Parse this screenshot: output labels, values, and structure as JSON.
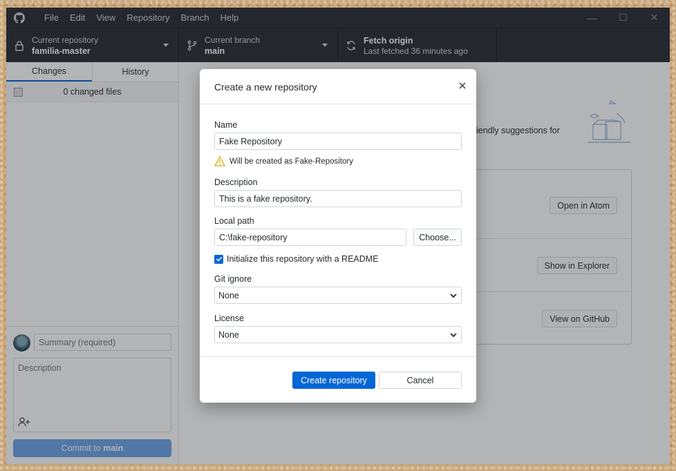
{
  "menu": [
    "File",
    "Edit",
    "View",
    "Repository",
    "Branch",
    "Help"
  ],
  "window_controls": {
    "minimize": "—",
    "maximize": "☐",
    "close": "✕"
  },
  "toolbar": {
    "repo_label": "Current repository",
    "repo_value": "familia-master",
    "branch_label": "Current branch",
    "branch_value": "main",
    "fetch_label": "Fetch origin",
    "fetch_value": "Last fetched 36 minutes ago"
  },
  "sidebar": {
    "tabs": [
      "Changes",
      "History"
    ],
    "changed_files": "0 changed files",
    "summary_placeholder": "Summary (required)",
    "description_placeholder": "Description",
    "commit_prefix": "Commit to ",
    "commit_branch": "main"
  },
  "main": {
    "suggestion_text": "iendly suggestions for",
    "actions": [
      "Open in Atom",
      "Show in Explorer",
      "View on GitHub"
    ]
  },
  "dialog": {
    "title": "Create a new repository",
    "name_label": "Name",
    "name_value": "Fake Repository",
    "warning": "Will be created as Fake-Repository",
    "description_label": "Description",
    "description_value": "This is a fake repository.",
    "local_path_label": "Local path",
    "local_path_value": "C:\\fake-repository",
    "choose_button": "Choose...",
    "readme_label": "Initialize this repository with a README",
    "gitignore_label": "Git ignore",
    "gitignore_value": "None",
    "license_label": "License",
    "license_value": "None",
    "create_button": "Create repository",
    "cancel_button": "Cancel"
  },
  "colors": {
    "accent": "#0366d6",
    "titlebar": "#24292e",
    "warning": "#dbab09"
  }
}
